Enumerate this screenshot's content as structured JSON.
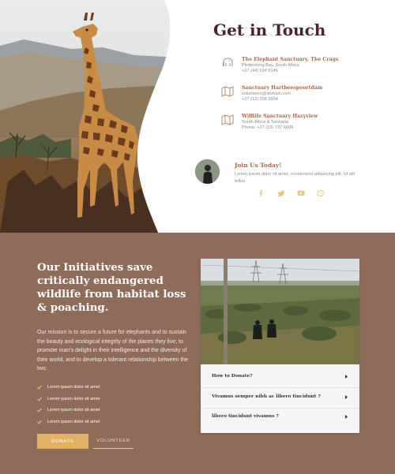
{
  "contact": {
    "title": "Get in Touch",
    "locations": [
      {
        "name": "The Elephant Sanctuary, The Crags",
        "line1": "Plettenberg Bay, South Africa",
        "line2": "+27 (44) 534 8145"
      },
      {
        "name": "Sanctuary Hartbeespoortdam",
        "line1": "volunteers@domain.com",
        "line2": "+27 (12) 258 9904"
      },
      {
        "name": "Wilflife Sanctuary Hazyview",
        "line1": "South Africa & Tanzania",
        "line2": "Phone: +27 (13) 737 6609"
      }
    ],
    "join": {
      "title": "Join Us Today!",
      "text": "Lorem ipsum dolor sit amet, consectetur adipiscing elit. Ut elit tellus."
    },
    "socials": [
      "facebook-icon",
      "twitter-icon",
      "youtube-icon",
      "whatsapp-icon"
    ]
  },
  "initiatives": {
    "title": "Our Initiatives save critically endangered wildlife from habitat loss & poaching.",
    "body": "Our mission is to secure a future for elephants and to sustain the beauty and ecological integrity of the places they live; to promote man's delight in their intelligence and the diversity of their world, and to develop a tolerant relationship between the two.",
    "checklist": [
      "Lorem ipsum dolor sit amet",
      "Lorem ipsum dolor sit amet",
      "Lorem ipsum dolor sit amet",
      "Lorem ipsum dolor sit amet"
    ],
    "donate_label": "DONATE",
    "volunteer_label": "VOLUNTEER"
  },
  "faq": [
    {
      "question": "How to Donate?"
    },
    {
      "question": "Vivamus semper nibh ac libero tincidunt ?"
    },
    {
      "question": "libero tincidunt vivamus ?"
    }
  ],
  "colors": {
    "title": "#4a2331",
    "accent": "#a66a4c",
    "social": "#e8c77e",
    "section_bg": "#8f6b59",
    "button": "#e2b364"
  }
}
